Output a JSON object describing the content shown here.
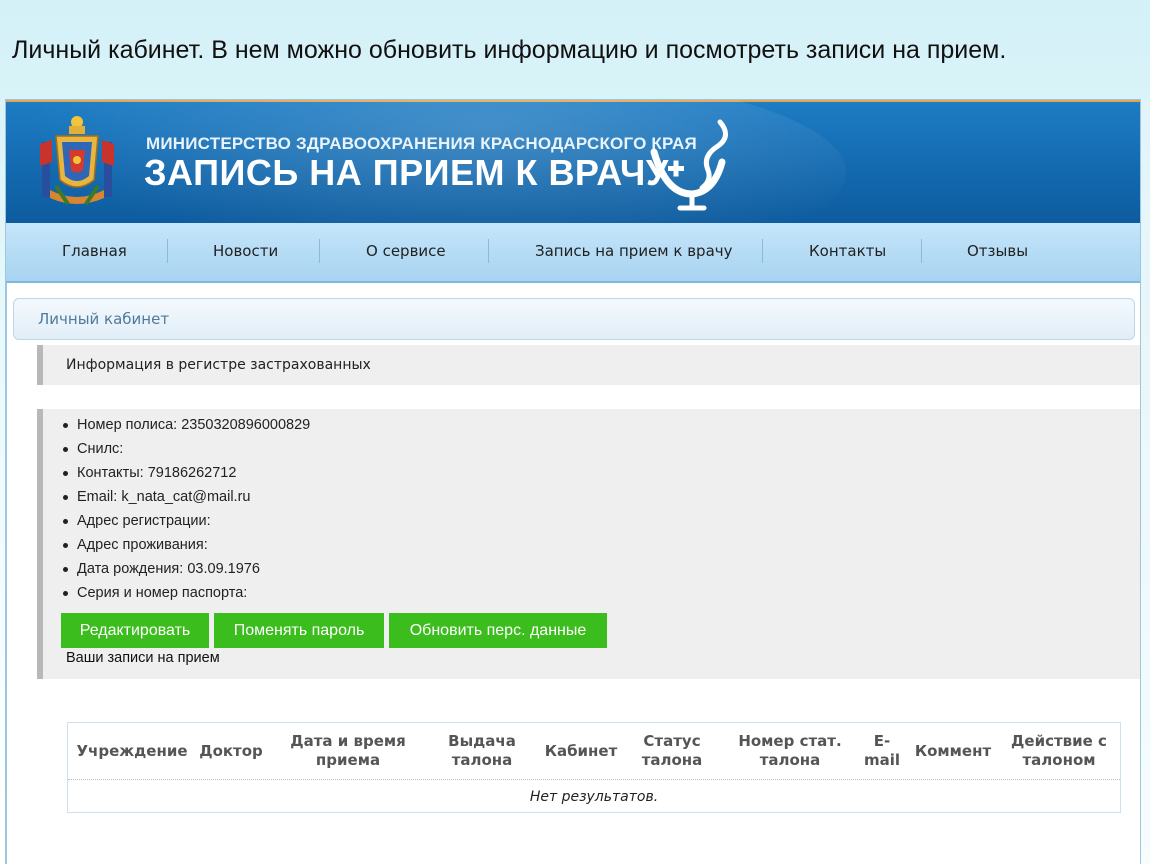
{
  "slide_caption": "Личный кабинет. В нем можно обновить информацию и посмотреть записи на прием.",
  "header": {
    "ministry": "МИНИСТЕРСТВО ЗДРАВООХРАНЕНИЯ КРАСНОДАРСКОГО КРАЯ",
    "title": "ЗАПИСЬ НА ПРИЕМ К ВРАЧУ"
  },
  "nav": [
    "Главная",
    "Новости",
    "О сервисе",
    "Запись на прием к врачу",
    "Контакты",
    "Отзывы"
  ],
  "section_title": "Личный кабинет",
  "info_header": "Информация в регистре застрахованных",
  "info_items": [
    "Номер полиса: 2350320896000829",
    "Снилс:",
    "Контакты: 79186262712",
    "Email: k_nata_cat@mail.ru",
    "Адрес регистрации:",
    "Адрес проживания:",
    "Дата рождения: 03.09.1976",
    "Серия и номер паспорта:"
  ],
  "buttons": {
    "edit": "Редактировать",
    "change_password": "Поменять пароль",
    "update_data": "Обновить перс. данные"
  },
  "records_label": "Ваши записи на прием",
  "table": {
    "columns": [
      [
        "Учреждение"
      ],
      [
        "Доктор"
      ],
      [
        "Дата и время",
        "приема"
      ],
      [
        "Выдача",
        "талона"
      ],
      [
        "Кабинет"
      ],
      [
        "Статус",
        "талона"
      ],
      [
        "Номер стат.",
        "талона"
      ],
      [
        "E-",
        "mail"
      ],
      [
        "Коммент"
      ],
      [
        "Действие с",
        "талоном"
      ]
    ],
    "empty_text": "Нет результатов."
  },
  "colors": {
    "banner": "#1368ad",
    "nav": "#b6dcf5",
    "button": "#3cbd1e"
  }
}
